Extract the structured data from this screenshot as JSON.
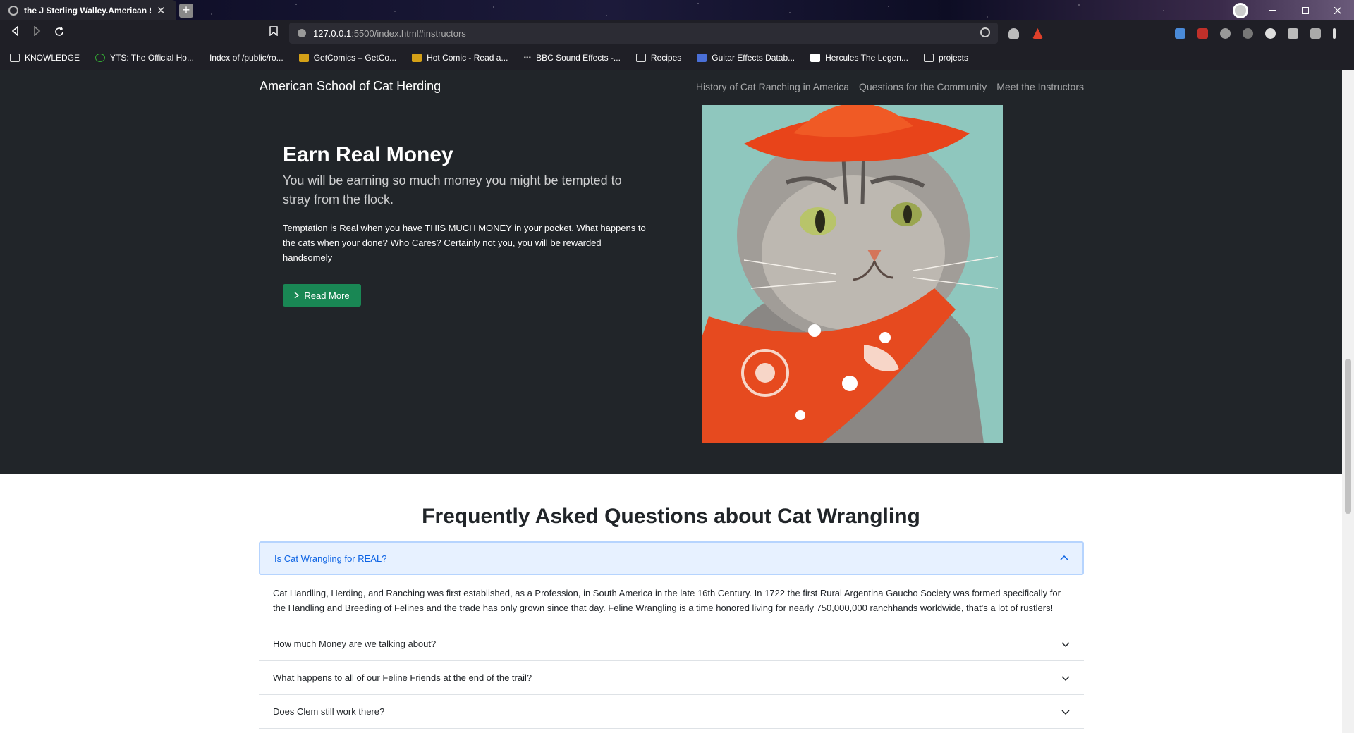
{
  "browser": {
    "tab_title": "the J Sterling Walley.American Sc",
    "tab_close": "✕",
    "new_tab": "+",
    "url_host": "127.0.0.1",
    "url_path": ":5500/index.html#instructors",
    "bookmarks": [
      {
        "label": "KNOWLEDGE",
        "icon": "folder-icon"
      },
      {
        "label": "YTS: The Official Ho...",
        "icon": "yts-icon"
      },
      {
        "label": "Index of /public/ro...",
        "icon": "page-icon"
      },
      {
        "label": "GetComics – GetCo...",
        "icon": "getcomics-icon"
      },
      {
        "label": "Hot Comic - Read a...",
        "icon": "hotcomic-icon"
      },
      {
        "label": "BBC Sound Effects -...",
        "icon": "bbc-icon"
      },
      {
        "label": "Recipes",
        "icon": "folder-icon"
      },
      {
        "label": "Guitar Effects Datab...",
        "icon": "guitar-icon"
      },
      {
        "label": "Hercules The Legen...",
        "icon": "hercules-icon"
      },
      {
        "label": "projects",
        "icon": "folder-icon"
      }
    ]
  },
  "site": {
    "title": "American School of Cat Herding",
    "nav": [
      "History of Cat Ranching in America",
      "Questions for the Community",
      "Meet the Instructors"
    ]
  },
  "hero": {
    "heading": "Earn Real Money",
    "lead": "You will be earning so much money you might be tempted to stray from the flock.",
    "body": "Temptation is Real when you have THIS MUCH MONEY in your pocket. What happens to the cats when your done? Who Cares? Certainly not you, you will be rewarded handsomely",
    "button": "Read More"
  },
  "faq": {
    "title": "Frequently Asked Questions about Cat Wrangling",
    "items": [
      {
        "question": "Is Cat Wrangling for REAL?",
        "answer": "Cat Handling, Herding, and Ranching was first established, as a Profession, in South America in the late 16th Century. In 1722 the first Rural Argentina Gaucho Society was formed specifically for the Handling and Breeding of Felines and the trade has only grown since that day. Feline Wrangling is a time honored living for nearly 750,000,000 ranchhands worldwide, that's a lot of rustlers!"
      },
      {
        "question": "How much Money are we talking about?"
      },
      {
        "question": "What happens to all of our Feline Friends at the end of the trail?"
      },
      {
        "question": "Does Clem still work there?"
      }
    ]
  },
  "colors": {
    "hero_bg": "#212529",
    "button_green": "#198754",
    "accordion_open_bg": "#e7f1ff",
    "accordion_open_text": "#0c63e4"
  }
}
